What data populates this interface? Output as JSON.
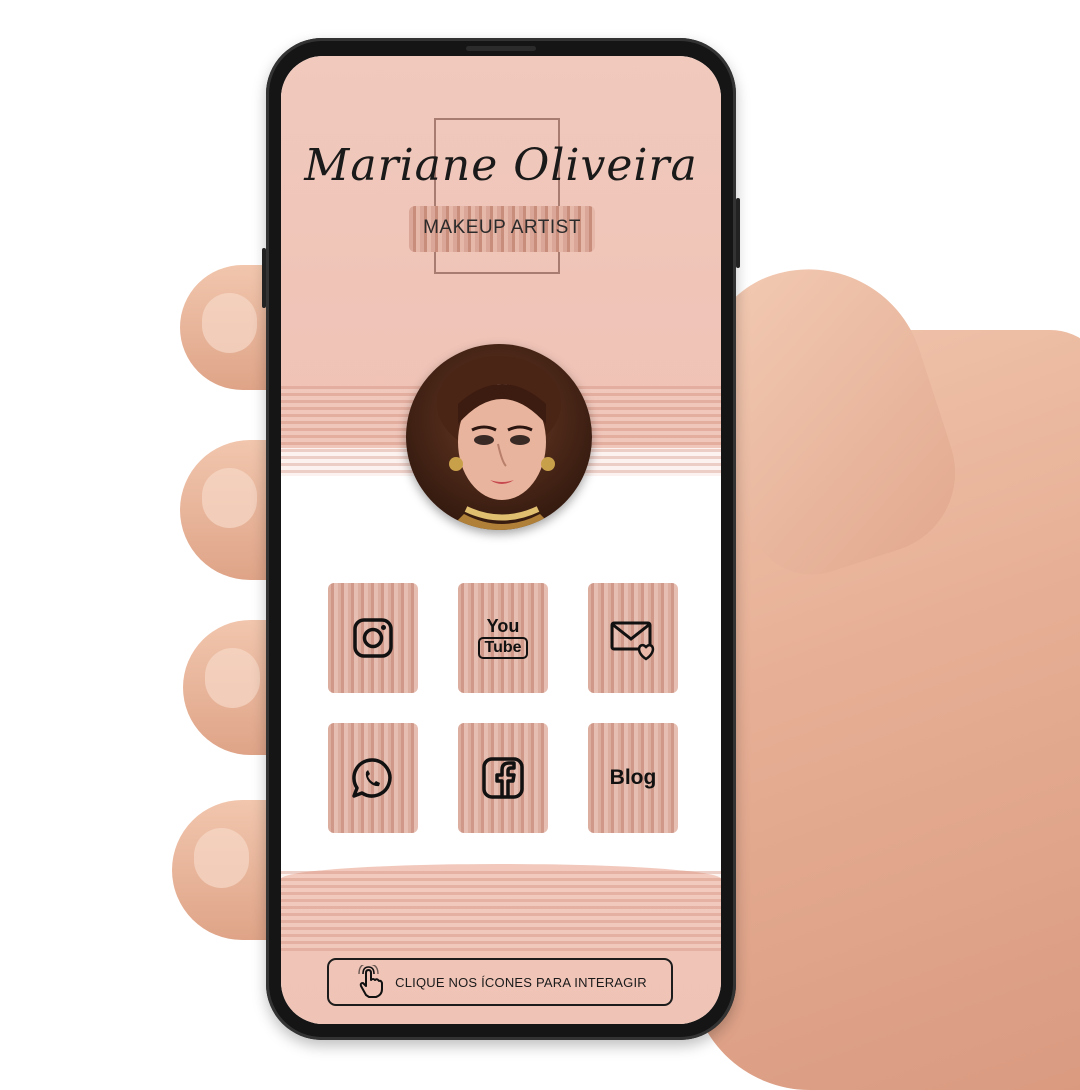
{
  "profile": {
    "name": "Mariane Oliveira",
    "title": "MAKEUP ARTIST"
  },
  "links": [
    {
      "id": "instagram",
      "icon": "instagram-icon"
    },
    {
      "id": "youtube",
      "icon": "youtube-icon",
      "label_top": "You",
      "label_bottom": "Tube"
    },
    {
      "id": "email",
      "icon": "mail-heart-icon"
    },
    {
      "id": "whatsapp",
      "icon": "whatsapp-icon"
    },
    {
      "id": "facebook",
      "icon": "facebook-icon"
    },
    {
      "id": "blog",
      "label": "Blog"
    }
  ],
  "cta": {
    "icon": "hand-pointer-icon",
    "label": "CLIQUE NOS ÍCONES PARA INTERAGIR"
  },
  "colors": {
    "blush": "#f1c9bd",
    "brush": "#d6a090",
    "ink": "#111111"
  }
}
